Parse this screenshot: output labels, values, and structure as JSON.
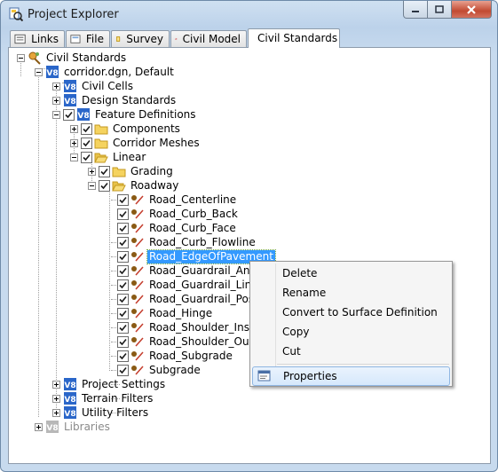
{
  "window": {
    "title": "Project Explorer"
  },
  "tabs": [
    {
      "label": "Links",
      "icon": "links-icon"
    },
    {
      "label": "File",
      "icon": "file-icon"
    },
    {
      "label": "Survey",
      "icon": "survey-icon"
    },
    {
      "label": "Civil Model",
      "icon": "civil-model-icon"
    },
    {
      "label": "Civil Standards",
      "icon": "civil-standards-icon",
      "active": true
    }
  ],
  "tree": {
    "root": "Civil Standards",
    "file": "corridor.dgn, Default",
    "civil_cells": "Civil Cells",
    "design_standards": "Design Standards",
    "feature_definitions": "Feature Definitions",
    "components": "Components",
    "corridor_meshes": "Corridor Meshes",
    "linear": "Linear",
    "grading": "Grading",
    "roadway": "Roadway",
    "roadway_items": [
      "Road_Centerline",
      "Road_Curb_Back",
      "Road_Curb_Face",
      "Road_Curb_Flowline",
      "Road_EdgeOfPavement",
      "Road_Guardrail_Anchor",
      "Road_Guardrail_Line",
      "Road_Guardrail_Post",
      "Road_Hinge",
      "Road_Shoulder_Inside",
      "Road_Shoulder_Outside",
      "Road_Subgrade",
      "Subgrade"
    ],
    "selected_item": "Road_EdgeOfPavement",
    "project_settings": "Project Settings",
    "terrain_filters": "Terrain Filters",
    "utility_filters": "Utility Filters",
    "libraries": "Libraries"
  },
  "context_menu": {
    "delete": "Delete",
    "rename": "Rename",
    "convert": "Convert to Surface Definition",
    "copy": "Copy",
    "cut": "Cut",
    "properties": "Properties"
  },
  "colors": {
    "selection": "#3399ff",
    "folder": "#f5d35f",
    "v8_icon": "#2a66c9"
  }
}
